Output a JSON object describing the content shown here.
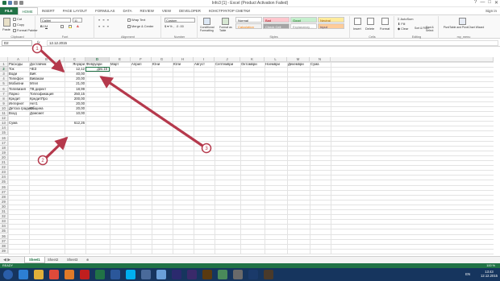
{
  "window": {
    "title": "Info3 [1] - Excel (Product Activation Failed)",
    "sign_in": "Sign in",
    "controls": [
      "?",
      "—",
      "□",
      "✕"
    ]
  },
  "ribbon_tabs": [
    "FILE",
    "HOME",
    "INSERT",
    "PAGE LAYOUT",
    "FORMULAS",
    "DATA",
    "REVIEW",
    "VIEW",
    "DEVELOPER",
    "КОНСТРУКТОР СМЕТКИ"
  ],
  "ribbon": {
    "clipboard": {
      "paste": "Paste",
      "cut": "Cut",
      "copy": "Copy",
      "format_painter": "Format Painter",
      "group": "Clipboard"
    },
    "font": {
      "name": "Calibri",
      "size": "11",
      "group": "Font"
    },
    "alignment": {
      "wrap": "Wrap Text",
      "merge": "Merge & Center",
      "group": "Alignment"
    },
    "number": {
      "format": "Custom",
      "group": "Number"
    },
    "styles": {
      "conditional": "Conditional Formatting",
      "format_table": "Format as Table",
      "cells": [
        {
          "label": "Normal",
          "bg": "#ffffff",
          "fg": "#222222"
        },
        {
          "label": "Bad",
          "bg": "#ffc7ce",
          "fg": "#9c0006"
        },
        {
          "label": "Good",
          "bg": "#c6efce",
          "fg": "#006100"
        },
        {
          "label": "Neutral",
          "bg": "#ffeb9c",
          "fg": "#9c5700"
        },
        {
          "label": "Calculation",
          "bg": "#f2f2f2",
          "fg": "#fa7d00"
        },
        {
          "label": "Check Cell",
          "bg": "#a5a5a5",
          "fg": "#ffffff"
        },
        {
          "label": "Explanatory ...",
          "bg": "#ffffff",
          "fg": "#7f7f7f"
        },
        {
          "label": "Input",
          "bg": "#ffcc99",
          "fg": "#3f3f76"
        }
      ],
      "group": "Styles"
    },
    "cells_group": {
      "insert": "Insert",
      "delete": "Delete",
      "format": "Format",
      "group": "Cells"
    },
    "editing": {
      "autosum": "AutoSum",
      "fill": "Fill",
      "clear": "Clear",
      "sort": "Sort & Filter",
      "find": "Find & Select",
      "group": "Editing"
    },
    "my_menu": {
      "pivot": "PivotTable and PivotChart Wizard",
      "group": "my_menu"
    }
  },
  "formula_bar": {
    "name_box": "D2",
    "fx": "fx",
    "value": "12.12.2015"
  },
  "columns": [
    "A",
    "B",
    "C",
    "D",
    "E",
    "F",
    "G",
    "H",
    "I",
    "J",
    "K",
    "L",
    "M",
    "N"
  ],
  "selected_column": "D",
  "selected_row": "2",
  "rows": [
    {
      "n": "1",
      "A": "Расходы",
      "B": "Доставчик",
      "C": "Януари",
      "D": "Февруари",
      "E": "Март",
      "F": "Април",
      "G": "Юни",
      "H": "Юли",
      "I": "Август",
      "J": "Септември",
      "K": "Октомври",
      "L": "Ноември",
      "M": "Декември",
      "N": "Сума"
    },
    {
      "n": "2",
      "A": "Ток",
      "B": "ЧЕЗ",
      "C": "12,12",
      "D": "дек.15"
    },
    {
      "n": "3",
      "A": "Води",
      "B": "ВиК",
      "C": "40,00"
    },
    {
      "n": "4",
      "A": "Телефон",
      "B": "Виваком",
      "C": "20,00"
    },
    {
      "n": "5",
      "A": "Мобилни",
      "B": "Мтел",
      "C": "21,00"
    },
    {
      "n": "6",
      "A": "Телевизия",
      "B": "ТВ директ",
      "C": "18,99"
    },
    {
      "n": "7",
      "A": "Парно",
      "B": "Топлофикация",
      "C": "250,15"
    },
    {
      "n": "8",
      "A": "Кредит",
      "B": "КредитПро",
      "C": "200,00"
    },
    {
      "n": "9",
      "A": "Интернет",
      "B": "Нет1",
      "C": "20,00"
    },
    {
      "n": "10",
      "A": "Детска градина",
      "B": "Община",
      "C": "20,00"
    },
    {
      "n": "11",
      "A": "Вход",
      "B": "Домсмет",
      "C": "10,00"
    },
    {
      "n": "12"
    },
    {
      "n": "13",
      "A": "Сума",
      "C": "612,26"
    },
    {
      "n": "14"
    },
    {
      "n": "15"
    },
    {
      "n": "16"
    },
    {
      "n": "17"
    },
    {
      "n": "18"
    },
    {
      "n": "19"
    },
    {
      "n": "20"
    },
    {
      "n": "21"
    },
    {
      "n": "22"
    },
    {
      "n": "23"
    },
    {
      "n": "24"
    },
    {
      "n": "25"
    },
    {
      "n": "26"
    },
    {
      "n": "27"
    },
    {
      "n": "28"
    },
    {
      "n": "29"
    },
    {
      "n": "30"
    },
    {
      "n": "31"
    },
    {
      "n": "32"
    },
    {
      "n": "33"
    },
    {
      "n": "34"
    },
    {
      "n": "35"
    },
    {
      "n": "36"
    },
    {
      "n": "37"
    },
    {
      "n": "38"
    },
    {
      "n": "39"
    }
  ],
  "annotations": [
    {
      "label": "1",
      "color": "#b5394c"
    },
    {
      "label": "2",
      "color": "#b5394c"
    },
    {
      "label": "3",
      "color": "#b5394c"
    }
  ],
  "sheets": [
    "Sheet1",
    "Sheet2",
    "Sheet3"
  ],
  "active_sheet": "Sheet1",
  "status": {
    "ready": "READY",
    "zoom": "100 %"
  },
  "taskbar": {
    "apps": [
      {
        "name": "start-icon",
        "color": "#2a5ea8"
      },
      {
        "name": "ie-icon",
        "color": "#2d7fd3"
      },
      {
        "name": "explorer-icon",
        "color": "#e0b03a"
      },
      {
        "name": "chrome-icon",
        "color": "#e04a3a"
      },
      {
        "name": "firefox-icon",
        "color": "#e07a28"
      },
      {
        "name": "acrobat-icon",
        "color": "#c01e1e"
      },
      {
        "name": "excel-icon",
        "color": "#217346"
      },
      {
        "name": "word-icon",
        "color": "#2b579a"
      },
      {
        "name": "skype-icon",
        "color": "#00aff0"
      },
      {
        "name": "media-icon",
        "color": "#4a6a9a"
      },
      {
        "name": "folder-icon",
        "color": "#6aa0d8"
      },
      {
        "name": "ae-icon",
        "color": "#2b2a6e"
      },
      {
        "name": "pr-icon",
        "color": "#3a2a6a"
      },
      {
        "name": "ai-icon",
        "color": "#5a3a10"
      },
      {
        "name": "paint-icon",
        "color": "#4a8a5a"
      },
      {
        "name": "gear-icon",
        "color": "#6a6a6a"
      },
      {
        "name": "ps-icon",
        "color": "#1a3a6a"
      },
      {
        "name": "bridge-icon",
        "color": "#4a3a2a"
      }
    ],
    "lang": "EN",
    "time": "13:43",
    "date": "12.12.2015"
  }
}
